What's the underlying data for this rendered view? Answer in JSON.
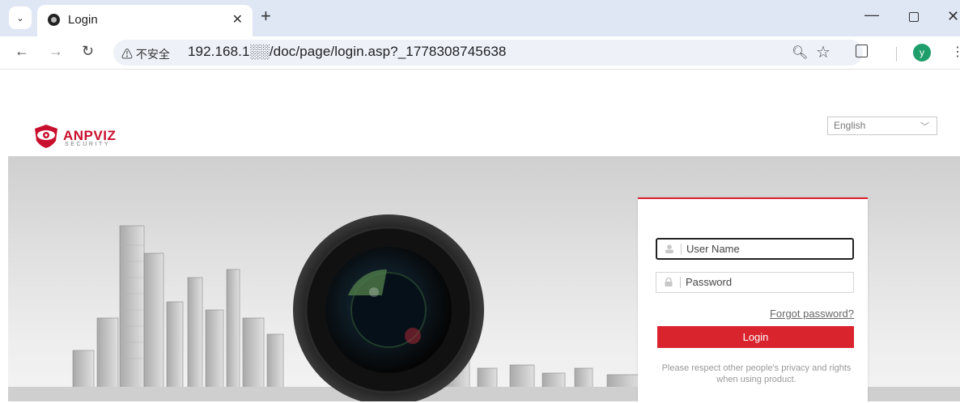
{
  "browser": {
    "tab": {
      "title": "Login"
    },
    "address": {
      "security": "⚠ 不安全",
      "url": "192.168.1░░/doc/page/login.asp?_1778308745638"
    },
    "profile_initial": "y"
  },
  "page": {
    "logo": {
      "word": "ANPVIZ",
      "sub": "SECURITY"
    },
    "language": {
      "selected": "English"
    },
    "login": {
      "username_placeholder": "User Name",
      "password_placeholder": "Password",
      "forgot_label": "Forgot password?",
      "login_label": "Login",
      "notice": "Please respect other people's privacy and rights when using product."
    }
  },
  "colors": {
    "brand_red": "#d9232d",
    "tab_strip": "#dfe7f5",
    "avatar": "#1e9e6a"
  }
}
